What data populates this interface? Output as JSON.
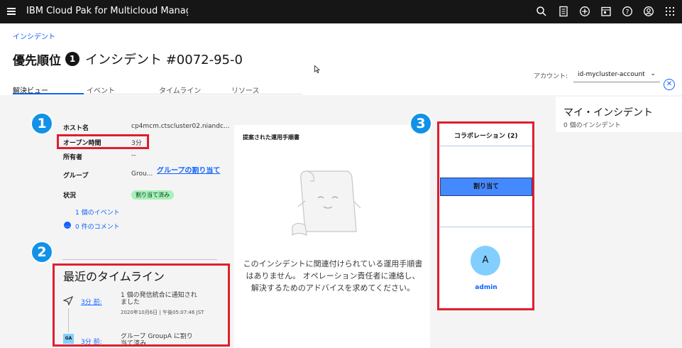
{
  "topbar": {
    "brand": "IBM Cloud Pak for Multicloud Management",
    "icons": [
      "search-icon",
      "document-icon",
      "add-icon",
      "calendar-icon",
      "help-icon",
      "user-icon",
      "apps-icon"
    ]
  },
  "breadcrumb": "インシデント",
  "page": {
    "priority_label": "優先順位",
    "priority_value": "1",
    "incident_title": "インシデント #0072-95-0"
  },
  "account": {
    "label": "アカウント:",
    "value": "id-mycluster-account"
  },
  "tabs": [
    "解決ビュー",
    "イベント",
    "タイムライン",
    "リソース"
  ],
  "details": {
    "host_label": "ホスト名",
    "host_value": "cp4mcm.ctscluster02.niandc...",
    "open_label": "オープン時間",
    "open_value": "3分",
    "owner_label": "所有者",
    "owner_value": "--",
    "group_label": "グループ",
    "group_value": "Grou...",
    "group_assign_link": "グループの割り当て",
    "status_label": "状況",
    "status_value": "割り当て済み",
    "events_link": "1 個のイベント",
    "comments_link": "0 件のコメント"
  },
  "markers": [
    "1",
    "2",
    "3"
  ],
  "timeline": {
    "title": "最近のタイムライン",
    "entries": [
      {
        "time": "3分 前:",
        "text": "1 個の発信統合に通知されました",
        "date": "2020年10月6日 | 午後05:07:46 JST"
      },
      {
        "time": "3分 前:",
        "text": "グループ GroupA に割り当て済み",
        "avatar": "GA"
      }
    ]
  },
  "runbook": {
    "title": "提案された運用手順書",
    "message": "このインシデントに関連付けられている運用手順書はありません。 オペレーション責任者に連絡し、解決するためのアドバイスを求めてください。"
  },
  "collaboration": {
    "title": "コラボレーション (2)",
    "assign_button": "割り当て",
    "avatar_initial": "A",
    "user_name": "admin"
  },
  "my_incidents": {
    "title": "マイ・インシデント",
    "count": "0 個のインシデント"
  },
  "colors": {
    "accent": "#0f62fe",
    "highlight_red": "#e01e2d",
    "marker_blue": "#1192e8"
  }
}
